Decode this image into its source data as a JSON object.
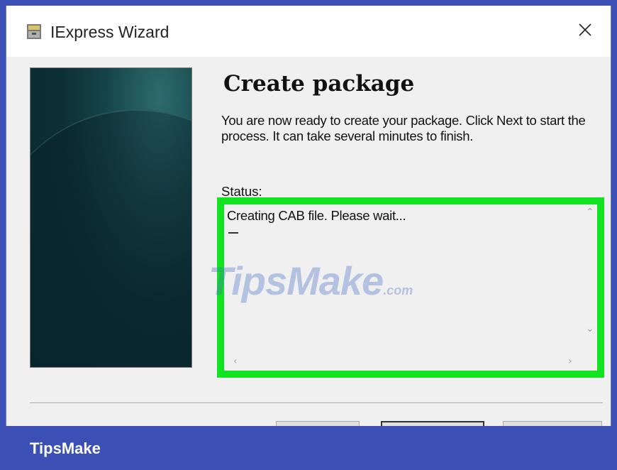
{
  "window": {
    "title": "IExpress Wizard",
    "close_icon": "close-icon"
  },
  "page": {
    "heading": "Create package",
    "description": "You are now ready to create your package.  Click Next to start the process.  It can take several minutes to finish.",
    "status_label": "Status:",
    "status_text": "Creating CAB file.  Please wait..."
  },
  "watermark": {
    "text": "TipsMake",
    "suffix": ".com"
  },
  "footer": {
    "brand": "TipsMake"
  },
  "colors": {
    "highlight": "#11e320",
    "footer_bg": "#3b4fb4"
  }
}
